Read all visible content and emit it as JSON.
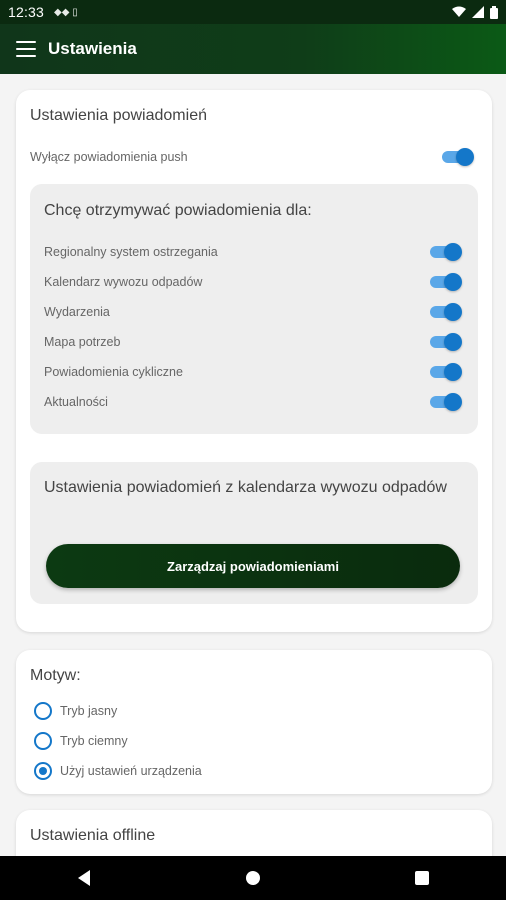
{
  "status_bar": {
    "time": "12:33",
    "left_icons": "◆◆  ▯",
    "battery": "▮"
  },
  "app_bar": {
    "title": "Ustawienia"
  },
  "notifications": {
    "title": "Ustawienia powiadomień",
    "push_label": "Wyłącz powiadomienia push",
    "push_enabled": true,
    "receive_title": "Chcę otrzymywać powiadomienia dla:",
    "categories": [
      {
        "label": "Regionalny system ostrzegania",
        "enabled": true
      },
      {
        "label": "Kalendarz wywozu odpadów",
        "enabled": true
      },
      {
        "label": "Wydarzenia",
        "enabled": true
      },
      {
        "label": "Mapa potrzeb",
        "enabled": true
      },
      {
        "label": "Powiadomienia cykliczne",
        "enabled": true
      },
      {
        "label": "Aktualności",
        "enabled": true
      }
    ],
    "waste_title": "Ustawienia powiadomień z kalendarza wywozu odpadów",
    "manage_button": "Zarządzaj powiadomieniami"
  },
  "theme": {
    "title": "Motyw:",
    "options": [
      {
        "label": "Tryb jasny",
        "selected": false
      },
      {
        "label": "Tryb ciemny",
        "selected": false
      },
      {
        "label": "Użyj ustawień urządzenia",
        "selected": true
      }
    ]
  },
  "offline": {
    "title": "Ustawienia offline"
  },
  "colors": {
    "accent": "#1477c9",
    "brand_dark": "#0c3a12"
  }
}
